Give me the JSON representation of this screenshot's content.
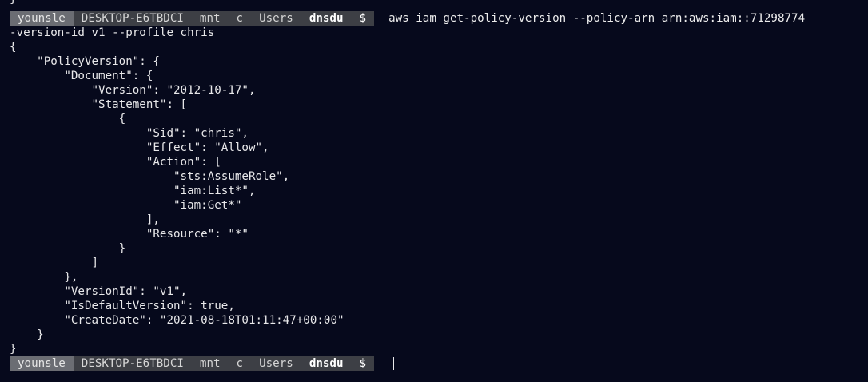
{
  "prompt": {
    "user": "younsle",
    "host": "DESKTOP-E6TBDCI",
    "path": [
      "mnt",
      "c",
      "Users",
      "dnsdu"
    ],
    "symbol": "$"
  },
  "lines": {
    "prev_close": "}",
    "command": "aws iam get-policy-version --policy-arn arn:aws:iam::71298774",
    "command_wrap": "-version-id v1 --profile chris",
    "output": [
      "{",
      "    \"PolicyVersion\": {",
      "        \"Document\": {",
      "            \"Version\": \"2012-10-17\",",
      "            \"Statement\": [",
      "                {",
      "                    \"Sid\": \"chris\",",
      "                    \"Effect\": \"Allow\",",
      "                    \"Action\": [",
      "                        \"sts:AssumeRole\",",
      "                        \"iam:List*\",",
      "                        \"iam:Get*\"",
      "                    ],",
      "                    \"Resource\": \"*\"",
      "                }",
      "            ]",
      "        },",
      "        \"VersionId\": \"v1\",",
      "        \"IsDefaultVersion\": true,",
      "        \"CreateDate\": \"2021-08-18T01:11:47+00:00\"",
      "    }",
      "}"
    ]
  }
}
